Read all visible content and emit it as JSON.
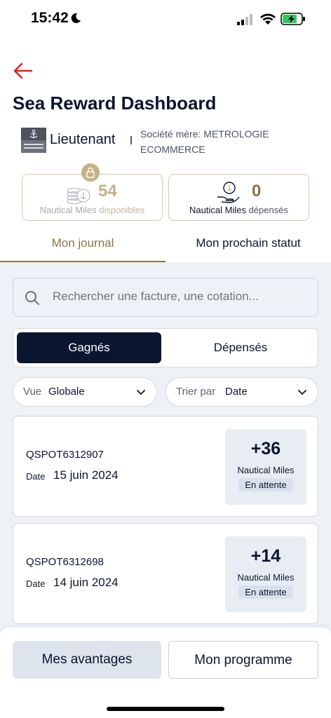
{
  "status_bar": {
    "time": "15:42"
  },
  "header": {
    "title": "Sea Reward Dashboard"
  },
  "rank": {
    "label": "Lieutenant",
    "company_line1": "Société mère: METROLOGIE",
    "company_line2": "ECOMMERCE"
  },
  "miles": {
    "available": {
      "value": "54",
      "unit": "Nautical Miles",
      "suffix": "disponibles"
    },
    "spent": {
      "value": "0",
      "unit": "Nautical Miles",
      "suffix": "dépensés"
    }
  },
  "tabs": [
    {
      "label": "Mon journal"
    },
    {
      "label": "Mon prochain statut"
    }
  ],
  "search": {
    "placeholder": "Rechercher une facture, une cotation..."
  },
  "segment": {
    "earned": "Gagnés",
    "spent": "Dépensés"
  },
  "filters": {
    "vue": {
      "label": "Vue",
      "value": "Globale"
    },
    "trier": {
      "label": "Trier par",
      "value": "Date"
    }
  },
  "transactions": [
    {
      "id": "QSPOT6312907",
      "date_label": "Date",
      "date": "15 juin 2024",
      "amount": "+36",
      "unit": "Nautical Miles",
      "status": "En attente"
    },
    {
      "id": "QSPOT6312698",
      "date_label": "Date",
      "date": "14 juin 2024",
      "amount": "+14",
      "unit": "Nautical Miles",
      "status": "En attente"
    }
  ],
  "bottom": {
    "avantages": "Mes avantages",
    "programme": "Mon programme"
  },
  "colors": {
    "navy": "#0b1530",
    "gold": "#8d7444",
    "accent_red": "#e0201b",
    "background": "#eef1f6"
  }
}
